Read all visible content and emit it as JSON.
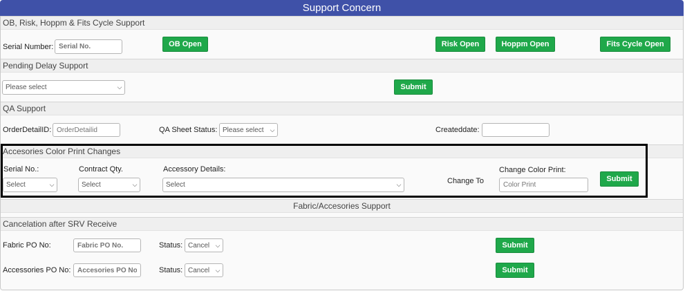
{
  "title": "Support Concern",
  "ob": {
    "header": "OB, Risk, Hoppm & Fits Cycle Support",
    "serial_label": "Serial Number:",
    "serial_placeholder": "Serial No.",
    "ob_btn": "OB Open",
    "risk_btn": "Risk Open",
    "hoppm_btn": "Hoppm Open",
    "fits_btn": "Fits Cycle Open"
  },
  "pending": {
    "header": "Pending Delay Support",
    "select_value": "Please select",
    "submit": "Submit"
  },
  "qa": {
    "header": "QA Support",
    "order_label": "OrderDetailID:",
    "order_placeholder": "OrderDetailid",
    "status_label": "QA Sheet Status:",
    "status_value": "Please select",
    "created_label": "Createddate:",
    "created_value": ""
  },
  "acc": {
    "header": "Accesories Color Print Changes",
    "serial_label": "Serial No.:",
    "serial_value": "Select",
    "qty_label": "Contract Qty.",
    "qty_value": "Select",
    "details_label": "Accessory Details:",
    "details_value": "Select",
    "change_to": "Change To",
    "color_label": "Change Color Print:",
    "color_placeholder": "Color Print",
    "submit": "Submit"
  },
  "fabric": {
    "header": "Fabric/Accesories Support"
  },
  "cancel": {
    "header": "Cancelation after SRV Receive",
    "fabric_label": "Fabric PO No:",
    "fabric_placeholder": "Fabric PO No.",
    "status_label": "Status:",
    "status_value": "Cancel",
    "submit": "Submit",
    "acc_label": "Accessories PO No:",
    "acc_placeholder": "Accesories PO No.",
    "status2_label": "Status:",
    "status2_value": "Cancel",
    "submit2": "Submit"
  }
}
